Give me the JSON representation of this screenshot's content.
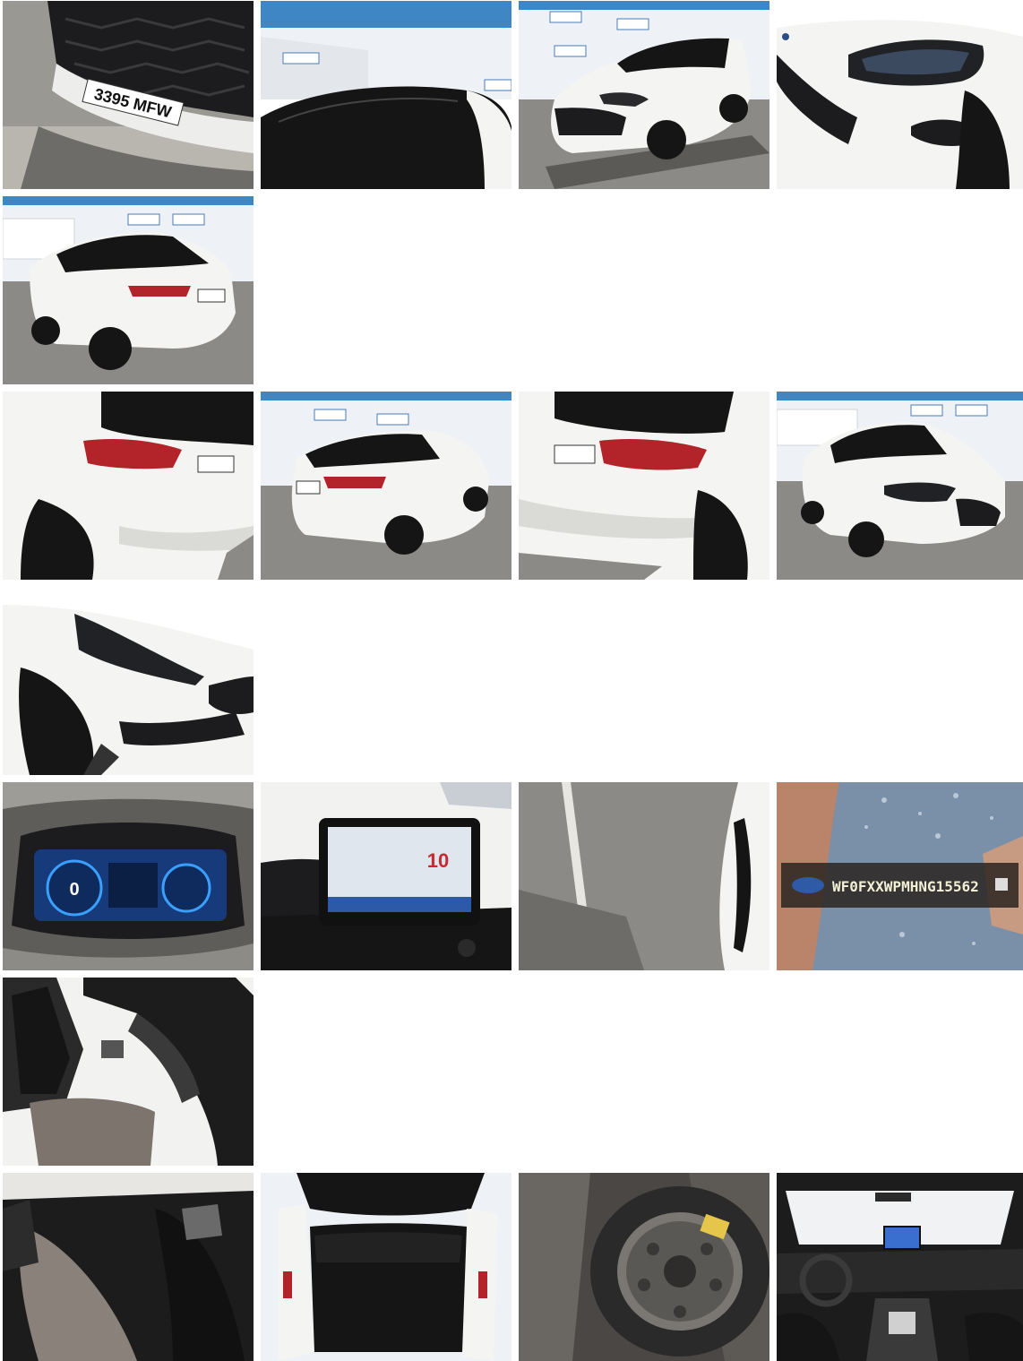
{
  "photos": [
    {
      "id": "front-grille-plate",
      "icon": "car-front-grille",
      "plate": "3395 MFW"
    },
    {
      "id": "black-roof",
      "icon": "car-roof"
    },
    {
      "id": "front-three-quarter",
      "icon": "car-front-three-quarter"
    },
    {
      "id": "headlight-close",
      "icon": "car-headlight"
    },
    {
      "id": "rear-three-quarter-left",
      "icon": "car-rear-three-quarter"
    },
    {
      "id": "rear-close-left",
      "icon": "car-rear"
    },
    {
      "id": "rear-three-quarter-wide",
      "icon": "car-rear-three-quarter"
    },
    {
      "id": "rear-close-right",
      "icon": "car-rear"
    },
    {
      "id": "front-three-quarter-right",
      "icon": "car-front-three-quarter"
    },
    {
      "id": "front-side-close",
      "icon": "car-front-side"
    },
    {
      "id": "instrument-cluster",
      "icon": "dashboard-gauge",
      "speed": "0"
    },
    {
      "id": "infotainment-screen",
      "icon": "infotainment-display",
      "temp": "10"
    },
    {
      "id": "parking-side",
      "icon": "car-side-parking"
    },
    {
      "id": "vin-plate",
      "icon": "vin-plate",
      "vin": "WF0FXXWPMHNG15562"
    },
    {
      "id": "front-seats",
      "icon": "car-seat"
    },
    {
      "id": "rear-seats",
      "icon": "car-seat"
    },
    {
      "id": "open-trunk",
      "icon": "car-trunk"
    },
    {
      "id": "spare-wheel",
      "icon": "spare-wheel"
    },
    {
      "id": "interior-dashboard",
      "icon": "car-interior"
    }
  ],
  "colors": {
    "car_body": "#f4f4f2",
    "car_black": "#151515",
    "asphalt": "#8c8a86",
    "sky": "#3f86c4",
    "wall": "#eef1f5",
    "tail_light": "#b3242a",
    "interior": "#1c1c1c",
    "screen": "#3a6fd0"
  }
}
